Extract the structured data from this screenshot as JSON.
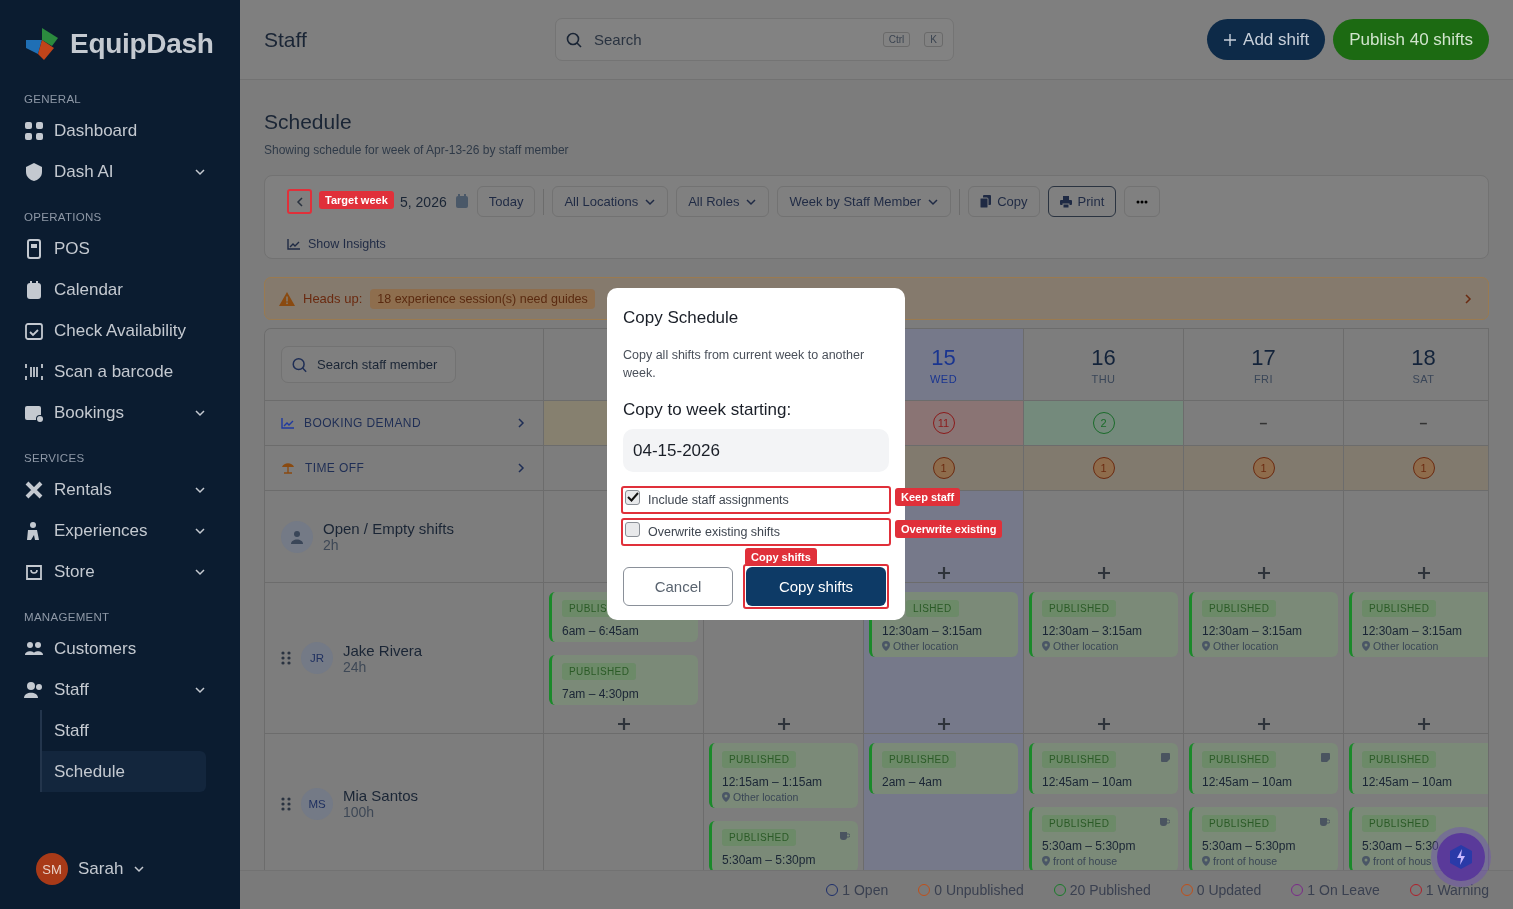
{
  "sidebar": {
    "brand": "EquipDash",
    "sections": [
      {
        "title": "GENERAL",
        "items": [
          {
            "label": "Dashboard",
            "submenu": false,
            "selected": false
          },
          {
            "label": "Dash AI",
            "submenu": true,
            "selected": false
          }
        ]
      },
      {
        "title": "OPERATIONS",
        "items": [
          {
            "label": "POS",
            "submenu": false,
            "selected": false
          },
          {
            "label": "Calendar",
            "submenu": false,
            "selected": false
          },
          {
            "label": "Check Availability",
            "submenu": false,
            "selected": false
          },
          {
            "label": "Scan a barcode",
            "submenu": false,
            "selected": false
          },
          {
            "label": "Bookings",
            "submenu": true,
            "selected": false
          }
        ]
      },
      {
        "title": "SERVICES",
        "items": [
          {
            "label": "Rentals",
            "submenu": true,
            "selected": false
          },
          {
            "label": "Experiences",
            "submenu": true,
            "selected": false
          },
          {
            "label": "Store",
            "submenu": true,
            "selected": false
          }
        ]
      },
      {
        "title": "MANAGEMENT",
        "items": [
          {
            "label": "Customers",
            "submenu": false,
            "selected": false
          },
          {
            "label": "Staff",
            "submenu": true,
            "selected": false,
            "children": [
              {
                "label": "Staff",
                "selected": false
              },
              {
                "label": "Schedule",
                "selected": true
              }
            ]
          }
        ]
      }
    ],
    "user": {
      "initials": "SM",
      "name": "Sarah"
    }
  },
  "header": {
    "title": "Staff",
    "search": {
      "placeholder": "Search",
      "keys": [
        "Ctrl",
        "K"
      ]
    },
    "buttons": [
      {
        "label": "Add shift",
        "kind": "add"
      },
      {
        "label": "Publish 40 shifts",
        "kind": "publish"
      }
    ]
  },
  "page": {
    "title": "Schedule",
    "subtitle": "Showing schedule for week of Apr-13-26 by staff member"
  },
  "toolbar": {
    "prev_annotation": "Target week",
    "date": "5, 2026",
    "controls": [
      {
        "label": "Today",
        "kind": "today",
        "divider_after": true
      },
      {
        "label": "All Locations",
        "kind": "dropdown",
        "divider_after": false
      },
      {
        "label": "All Roles",
        "kind": "dropdown",
        "divider_after": false
      },
      {
        "label": "Week by Staff Member",
        "kind": "dropdown",
        "divider_after": true
      },
      {
        "label": "Copy",
        "kind": "copy",
        "divider_after": false
      },
      {
        "label": "Print",
        "kind": "print",
        "divider_after": false
      },
      {
        "kind": "more",
        "divider_after": false
      }
    ],
    "insights": "Show Insights"
  },
  "notice": {
    "label": "Heads up:",
    "badge": "18 experience session(s) need guides"
  },
  "schedule": {
    "search": {
      "placeholder": "Search staff member"
    },
    "columns": [
      {
        "date": "15",
        "weekday": "WED",
        "today": true
      },
      {
        "date": "16",
        "weekday": "THU",
        "today": false
      },
      {
        "date": "17",
        "weekday": "FRI",
        "today": false
      },
      {
        "date": "18",
        "weekday": "SAT",
        "today": false
      }
    ],
    "booking_demand": {
      "label": "BOOKING DEMAND",
      "cells": [
        {
          "kind": "tinted"
        },
        {
          "kind": "empty"
        },
        {
          "kind": "high",
          "count": "11"
        },
        {
          "kind": "ok",
          "count": "2"
        },
        {
          "kind": "none",
          "text": "–"
        },
        {
          "kind": "none",
          "text": "–"
        }
      ]
    },
    "time_off": {
      "label": "TIME OFF",
      "cells": [
        {
          "kind": "empty"
        },
        {
          "kind": "empty"
        },
        {
          "kind": "leave",
          "count": "1"
        },
        {
          "kind": "leave",
          "count": "1"
        },
        {
          "kind": "leave",
          "count": "1"
        },
        {
          "kind": "leave",
          "count": "1"
        }
      ]
    },
    "staff": [
      {
        "kind": "open",
        "name": "Open / Empty shifts",
        "hours": "2h",
        "cells": [
          {},
          {},
          {
            "add": true
          },
          {
            "add": true
          },
          {
            "add": true
          },
          {
            "add": true
          }
        ]
      },
      {
        "kind": "member",
        "initials": "JR",
        "name": "Jake Rivera",
        "hours": "24h",
        "cells": [
          {
            "add": true,
            "shifts": [
              {
                "kind": "published",
                "status": "PUBLIS",
                "time": "6am – 6:45am"
              },
              {
                "kind": "published",
                "status": "PUBLISHED",
                "time": "7am – 4:30pm"
              }
            ]
          },
          {
            "add": true
          },
          {
            "add": true,
            "shifts": [
              {
                "kind": "published",
                "status": "LISHED",
                "clipped": true,
                "time": "12:30am – 3:15am",
                "location": "Other location"
              }
            ]
          },
          {
            "add": true,
            "shifts": [
              {
                "kind": "published",
                "status": "PUBLISHED",
                "time": "12:30am – 3:15am",
                "location": "Other location"
              }
            ]
          },
          {
            "add": true,
            "shifts": [
              {
                "kind": "published",
                "status": "PUBLISHED",
                "time": "12:30am – 3:15am",
                "location": "Other location"
              }
            ]
          },
          {
            "add": true,
            "shifts": [
              {
                "kind": "published",
                "status": "PUBLISHED",
                "time": "12:30am – 3:15am",
                "location": "Other location"
              }
            ]
          }
        ]
      },
      {
        "kind": "member",
        "initials": "MS",
        "name": "Mia Santos",
        "hours": "100h",
        "cells": [
          {
            "add": false
          },
          {
            "add": false,
            "shifts": [
              {
                "kind": "published",
                "status": "PUBLISHED",
                "time": "12:15am – 1:15am",
                "location": "Other location"
              },
              {
                "kind": "published",
                "status": "PUBLISHED",
                "time": "5:30am – 5:30pm",
                "break": true
              }
            ]
          },
          {
            "add": false,
            "shifts": [
              {
                "kind": "published",
                "status": "PUBLISHED",
                "time": "2am – 4am"
              }
            ]
          },
          {
            "add": false,
            "shifts": [
              {
                "kind": "published",
                "status": "PUBLISHED",
                "time": "12:45am – 10am",
                "note": true
              },
              {
                "kind": "published",
                "status": "PUBLISHED",
                "time": "5:30am – 5:30pm",
                "location": "front of house",
                "break": true
              }
            ]
          },
          {
            "add": false,
            "shifts": [
              {
                "kind": "published",
                "status": "PUBLISHED",
                "time": "12:45am – 10am",
                "note": true
              },
              {
                "kind": "published",
                "status": "PUBLISHED",
                "time": "5:30am – 5:30pm",
                "location": "front of house",
                "break": true
              }
            ]
          },
          {
            "add": false,
            "shifts": [
              {
                "kind": "published",
                "status": "PUBLISHED",
                "time": "12:45am – 10am"
              },
              {
                "kind": "published",
                "status": "PUBLISHED",
                "time": "5:30am – 5:30",
                "location": "front of hous"
              }
            ]
          }
        ]
      }
    ]
  },
  "status_bar": [
    {
      "label": "1 Open",
      "color": "#1e2f6b"
    },
    {
      "label": "0 Unpublished",
      "color": "#c0501a"
    },
    {
      "label": "20 Published",
      "color": "#1a7a2a"
    },
    {
      "label": "0 Updated",
      "color": "#c0501a"
    },
    {
      "label": "1 On Leave",
      "color": "#7a2a8a"
    },
    {
      "label": "1 Warning",
      "color": "#b0202a"
    }
  ],
  "dialog": {
    "title": "Copy Schedule",
    "description": "Copy all shifts from current week to another week.",
    "field_label": "Copy to week starting:",
    "value": "04-15-2026",
    "options": [
      {
        "label": "Include staff assignments",
        "checked": true,
        "annotation": "Keep staff"
      },
      {
        "label": "Overwrite existing shifts",
        "checked": false,
        "annotation": "Overwrite existing"
      }
    ],
    "buttons": [
      {
        "label": "Cancel",
        "kind": "secondary"
      },
      {
        "label": "Copy shifts",
        "kind": "primary",
        "annotation": "Copy shifts"
      }
    ]
  }
}
